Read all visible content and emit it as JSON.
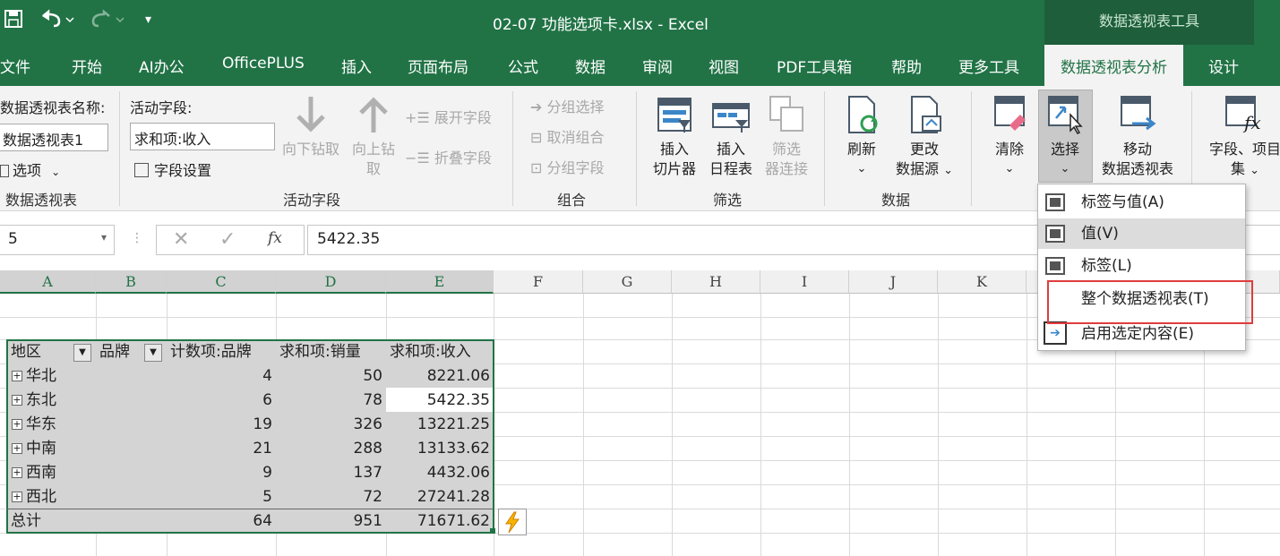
{
  "window": {
    "title": "02-07 功能选项卡.xlsx  -  Excel",
    "context_tools": "数据透视表工具"
  },
  "tabs": [
    "文件",
    "开始",
    "AI办公",
    "OfficePLUS",
    "插入",
    "页面布局",
    "公式",
    "数据",
    "审阅",
    "视图",
    "PDF工具箱",
    "帮助",
    "更多工具",
    "数据透视表分析",
    "设计"
  ],
  "ribbon": {
    "pivot_name_label": "数据透视表名称:",
    "pivot_name_value": "数据透视表1",
    "options_label": "选项",
    "group_pivot": "数据透视表",
    "active_field_label": "活动字段:",
    "active_field_value": "求和项:收入",
    "field_settings": "字段设置",
    "drill_down": "向下钻取",
    "drill_up_1": "向上钻",
    "drill_up_2": "取",
    "expand_field": "展开字段",
    "collapse_field": "折叠字段",
    "group_active_field": "活动字段",
    "group_selection": "分组选择",
    "ungroup": "取消组合",
    "group_field": "分组字段",
    "group_group": "组合",
    "insert_slicer_1": "插入",
    "insert_slicer_2": "切片器",
    "insert_timeline_1": "插入",
    "insert_timeline_2": "日程表",
    "filter_conn_1": "筛选",
    "filter_conn_2": "器连接",
    "group_filter": "筛选",
    "refresh": "刷新",
    "change_source_1": "更改",
    "change_source_2": "数据源",
    "group_data": "数据",
    "clear": "清除",
    "select": "选择",
    "move_1": "移动",
    "move_2": "数据透视表",
    "fields_1": "字段、项目",
    "fields_2": "集"
  },
  "formula_bar": {
    "name_box": "5",
    "fx": "fx",
    "value": "5422.35"
  },
  "columns": [
    "A",
    "B",
    "C",
    "D",
    "E",
    "F",
    "G",
    "H",
    "I",
    "J",
    "K"
  ],
  "pivot": {
    "headers": [
      "地区",
      "品牌",
      "计数项:品牌",
      "求和项:销量",
      "求和项:收入"
    ],
    "rows": [
      {
        "region": "华北",
        "count": "4",
        "qty": "50",
        "revenue": "8221.06"
      },
      {
        "region": "东北",
        "count": "6",
        "qty": "78",
        "revenue": "5422.35"
      },
      {
        "region": "华东",
        "count": "19",
        "qty": "326",
        "revenue": "13221.25"
      },
      {
        "region": "中南",
        "count": "21",
        "qty": "288",
        "revenue": "13133.62"
      },
      {
        "region": "西南",
        "count": "9",
        "qty": "137",
        "revenue": "4432.06"
      },
      {
        "region": "西北",
        "count": "5",
        "qty": "72",
        "revenue": "27241.28"
      }
    ],
    "total": {
      "label": "总计",
      "count": "64",
      "qty": "951",
      "revenue": "71671.62"
    }
  },
  "dropdown": {
    "items": [
      "标签与值(A)",
      "值(V)",
      "标签(L)",
      "整个数据透视表(T)",
      "启用选定内容(E)"
    ]
  },
  "colors": {
    "excel_green": "#217346",
    "highlight_red": "#e03c3c"
  }
}
